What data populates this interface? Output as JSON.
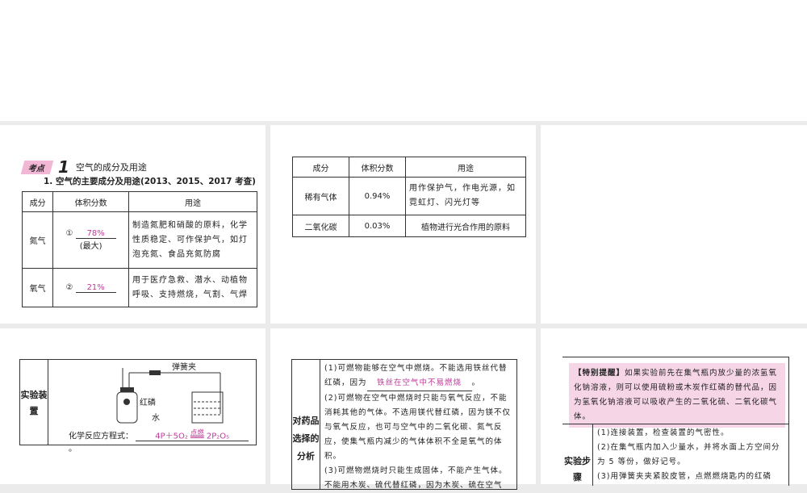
{
  "section": {
    "badge": "考点",
    "number": "1",
    "title": "空气的成分及用途",
    "subtitle": "1. 空气的主要成分及用途(2013、2015、2017 考查)"
  },
  "table1": {
    "headers": [
      "成分",
      "体积分数",
      "用途"
    ],
    "rows": [
      {
        "name": "氮气",
        "marker": "①",
        "value": "78%",
        "note": "(最大)",
        "use": "制造氮肥和硝酸的原料，化学性质稳定、可作保护气，如灯泡充氮、食品充氮防腐"
      },
      {
        "name": "氧气",
        "marker": "②",
        "value": "21%",
        "note": "",
        "use": "用于医疗急救、潜水、动植物呼吸、支持燃烧，气割、气焊"
      }
    ]
  },
  "table2": {
    "headers": [
      "成分",
      "体积分数",
      "用途"
    ],
    "rows": [
      {
        "name": "稀有气体",
        "value": "0.94%",
        "use": "用作保护气，作电光源，如霓虹灯、闪光灯等"
      },
      {
        "name": "二氧化碳",
        "value": "0.03%",
        "use": "植物进行光合作用的原料"
      }
    ]
  },
  "apparatus": {
    "label": "实验装置",
    "clip": "弹簧夹",
    "phosphorus": "红磷",
    "water": "水",
    "equation_label": "化学反应方程式：",
    "equation": "4P＋5O₂",
    "condition": "点燃",
    "product": "2P₂O₅",
    "period": "。"
  },
  "analysis": {
    "label": "对药品选择的分析",
    "p1a": "(1)可燃物能够在空气中燃烧。不能选用铁丝代替红磷，因为",
    "p1_answer": "铁丝在空气中不易燃烧",
    "p1b": "。",
    "p2": "(2)可燃物在空气中燃烧时只能与氧气反应，不能消耗其他的气体。不选用镁代替红磷，因为镁不仅与氧气反应，也可与空气中的二氧化碳、氮气反应，使集气瓶内减少的气体体积不全是氧气的体积。",
    "p3": "(3)可燃物燃烧时只能生成固体，不能产生气体。不能用木炭、硫代替红磷，因为木炭、硫在空气"
  },
  "tip": {
    "title": "【特别提醒】",
    "text": "如果实验前先在集气瓶内放少量的浓氢氧化钠溶液，则可以使用硫粉或木炭作红磷的替代品，因为氢氧化钠溶液可以吸收产生的二氧化硫、二氧化碳气体。"
  },
  "steps": {
    "label": "实验步骤",
    "s1": "(1)连接装置，检查装置的气密性。",
    "s2": "(2)在集气瓶内加入少量水，并将水面上方空间分为 5 等份，做好记号。",
    "s3": "(3)用弹簧夹夹紧胶皮管，点燃燃烧匙内的红磷"
  }
}
